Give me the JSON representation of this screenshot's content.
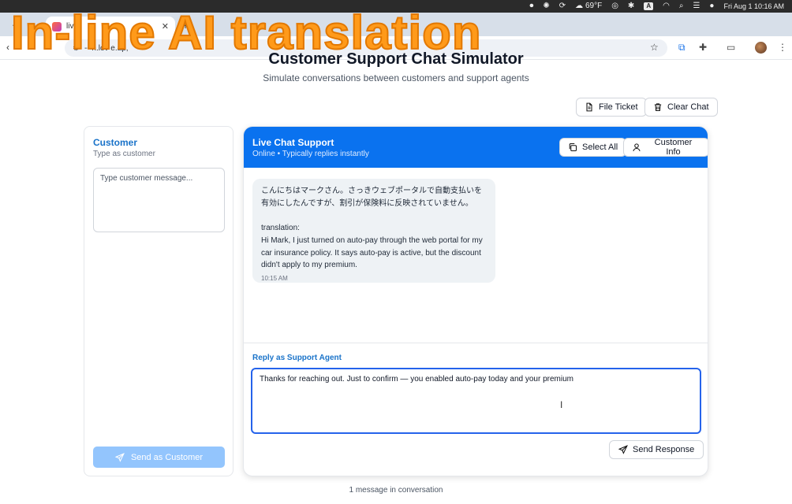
{
  "overlay": {
    "caption": "In-line AI translation"
  },
  "menubar": {
    "weather": "69°F",
    "key_label": "A",
    "clock": "Fri Aug 1  10:16 AM"
  },
  "browser": {
    "tab_title": "live",
    "url": "--  n.lov  e.ap,"
  },
  "page": {
    "title": "Customer Support Chat Simulator",
    "subtitle": "Simulate conversations between customers and support agents",
    "file_ticket": "File Ticket",
    "clear_chat": "Clear Chat",
    "message_count": "1 message in conversation"
  },
  "customer": {
    "title": "Customer",
    "subtitle": "Type as customer",
    "placeholder": "Type customer message...",
    "send_label": "Send as Customer"
  },
  "chat": {
    "title": "Live Chat Support",
    "status": "Online • Typically replies instantly",
    "select_all": "Select All",
    "customer_info": "Customer Info",
    "messages": [
      {
        "text": "こんにちはマークさん。さっきウェブポータルで自動支払いを有効にしたんですが、割引が保険料に反映されていません。\n\ntranslation:\nHi Mark, I just turned on auto-pay through the web portal for my car insurance policy. It says auto-pay is active, but the discount didn't apply to my premium.",
        "time": "10:15 AM"
      }
    ]
  },
  "reply": {
    "label": "Reply as Support Agent",
    "value": "Thanks for reaching out. Just to confirm — you enabled auto-pay today and your premium",
    "send_label": "Send Response"
  }
}
